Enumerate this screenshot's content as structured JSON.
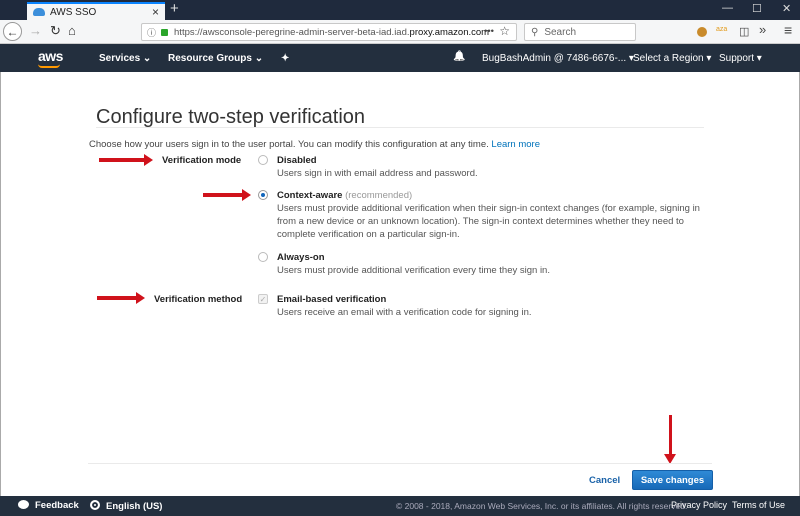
{
  "browser": {
    "tab_title": "AWS SSO",
    "url_prefix": "https://awsconsole-peregrine-admin-server-beta-iad.iad.",
    "url_domain": "proxy.amazon.com",
    "search_placeholder": "Search",
    "icons": {
      "back": "←",
      "forward": "→",
      "reload": "↻",
      "home": "⌂",
      "more": "•••",
      "bookmark": "☆",
      "search": "⚲",
      "sidebar": "◫",
      "overflow": "»",
      "menu": "≡",
      "close_tab": "×",
      "new_tab": "+",
      "minimize": "—",
      "maximize": "☐",
      "close_window": "✕"
    }
  },
  "aws_nav": {
    "logo": "aws",
    "services": "Services ⌄",
    "resource_groups": "Resource Groups ⌄",
    "pin_icon": "✦",
    "bell_icon": "🔔",
    "account": "BugBashAdmin @ 7486-6676-... ▾",
    "region": "Select a Region ▾",
    "support": "Support ▾"
  },
  "page": {
    "title": "Configure two-step verification",
    "intro": "Choose how your users sign in to the user portal. You can modify this configuration at any time.",
    "learn_more": "Learn more",
    "verification_mode": {
      "label": "Verification mode",
      "selected": "Context-aware",
      "options": [
        {
          "title": "Disabled",
          "note": "",
          "desc": "Users sign in with email address and password."
        },
        {
          "title": "Context-aware",
          "note": "(recommended)",
          "desc": "Users must provide additional verification when their sign-in context changes (for example, signing in from a new device or an unknown location). The sign-in context determines whether they need to complete verification on a particular sign-in."
        },
        {
          "title": "Always-on",
          "note": "",
          "desc": "Users must provide additional verification every time they sign in."
        }
      ]
    },
    "verification_method": {
      "label": "Verification method",
      "checked": true,
      "title": "Email-based verification",
      "desc": "Users receive an email with a verification code for signing in."
    },
    "cancel": "Cancel",
    "save": "Save changes"
  },
  "footer": {
    "feedback": "Feedback",
    "language": "English (US)",
    "copyright": "© 2008 - 2018, Amazon Web Services, Inc. or its affiliates. All rights reserved.",
    "privacy": "Privacy Policy",
    "terms": "Terms of Use"
  }
}
